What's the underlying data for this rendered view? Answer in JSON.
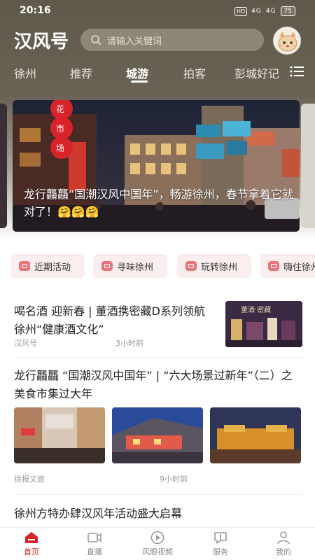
{
  "status_bar": {
    "time": "20:16",
    "hd": "HD",
    "signal1": "4G",
    "signal2": "4G",
    "battery": "75"
  },
  "app": {
    "logo": "汉风号",
    "search_placeholder": "请输入关键词"
  },
  "tabs": [
    "徐州",
    "推荐",
    "城游",
    "拍客",
    "彭城好记"
  ],
  "active_tab": 2,
  "banner": {
    "title": "龙行龘龘“国潮汉风中国年”，畅游徐州，春节拿着它就对了！🤗🤗🤗"
  },
  "chips": [
    "近期活动",
    "寻味徐州",
    "玩转徐州",
    "嗨住徐州"
  ],
  "articles": [
    {
      "title": "喝名酒 迎新春 | 董酒携密藏D系列领航徐州“健康酒文化”",
      "source": "汉风号",
      "time": "3小时前",
      "thumb_caption": "董酒·密藏"
    },
    {
      "title": "龙行龘龘 “国潮汉风中国年” | “六大场景过新年”（二）之美食市集过大年",
      "source": "徐报文旅",
      "time": "9小时前"
    },
    {
      "title": "徐州方特办肆汉风年活动盛大启幕"
    }
  ],
  "bottom_nav": [
    {
      "label": "首页",
      "icon": "home-icon"
    },
    {
      "label": "直播",
      "icon": "video-camera-icon"
    },
    {
      "label": "风眼视频",
      "icon": "play-circle-icon"
    },
    {
      "label": "服务",
      "icon": "service-icon"
    },
    {
      "label": "我的",
      "icon": "user-icon"
    }
  ],
  "colors": {
    "header_bg": "#5f594b",
    "accent_red": "#d8232a",
    "chip_bg": "#fbeeee",
    "chip_icon": "#e8747c"
  }
}
